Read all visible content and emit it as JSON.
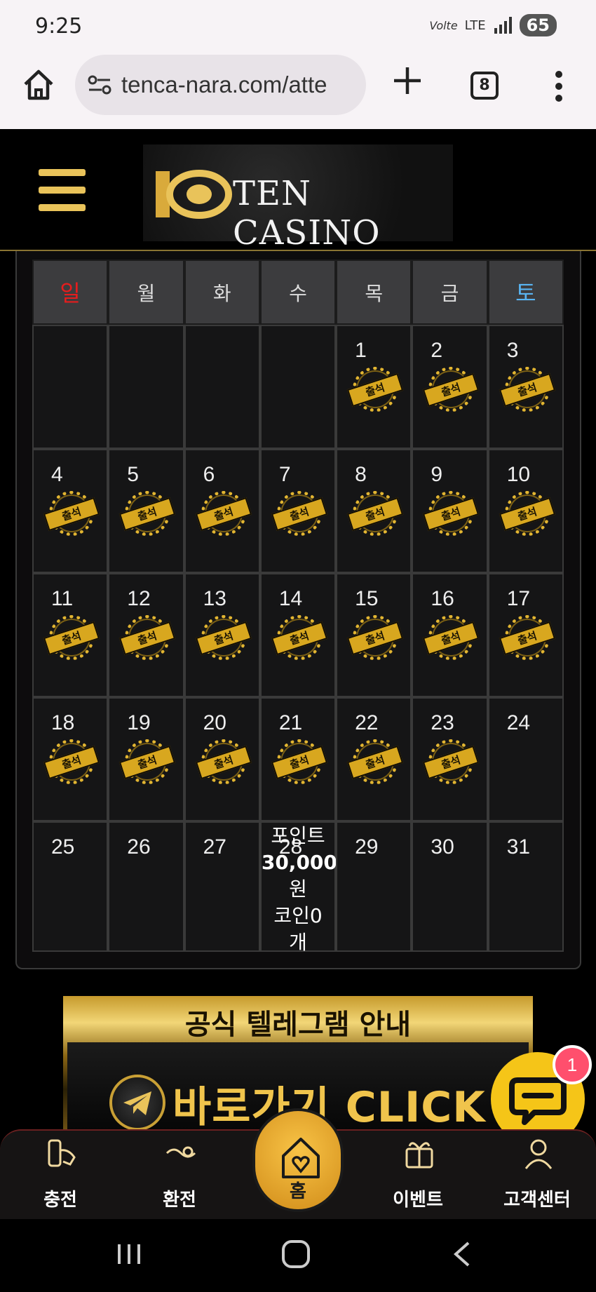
{
  "status_bar": {
    "time": "9:25",
    "volte": "Volte",
    "network": "LTE",
    "battery": "65"
  },
  "browser": {
    "url": "tenca-nara.com/atte",
    "tab_count": "8"
  },
  "site": {
    "logo_text": "TEN CASINO"
  },
  "calendar": {
    "weekdays": [
      "일",
      "월",
      "화",
      "수",
      "목",
      "금",
      "토"
    ],
    "stamp_label": "출석",
    "weeks": [
      [
        {
          "day": ""
        },
        {
          "day": ""
        },
        {
          "day": ""
        },
        {
          "day": ""
        },
        {
          "day": "1",
          "stamp": true
        },
        {
          "day": "2",
          "stamp": true
        },
        {
          "day": "3",
          "stamp": true
        }
      ],
      [
        {
          "day": "4",
          "stamp": true
        },
        {
          "day": "5",
          "stamp": true
        },
        {
          "day": "6",
          "stamp": true
        },
        {
          "day": "7",
          "stamp": true
        },
        {
          "day": "8",
          "stamp": true
        },
        {
          "day": "9",
          "stamp": true
        },
        {
          "day": "10",
          "stamp": true
        }
      ],
      [
        {
          "day": "11",
          "stamp": true
        },
        {
          "day": "12",
          "stamp": true
        },
        {
          "day": "13",
          "stamp": true
        },
        {
          "day": "14",
          "stamp": true
        },
        {
          "day": "15",
          "stamp": true
        },
        {
          "day": "16",
          "stamp": true
        },
        {
          "day": "17",
          "stamp": true
        }
      ],
      [
        {
          "day": "18",
          "stamp": true
        },
        {
          "day": "19",
          "stamp": true
        },
        {
          "day": "20",
          "stamp": true
        },
        {
          "day": "21",
          "stamp": true
        },
        {
          "day": "22",
          "stamp": true
        },
        {
          "day": "23",
          "stamp": true
        },
        {
          "day": "24"
        }
      ],
      [
        {
          "day": "25"
        },
        {
          "day": "26"
        },
        {
          "day": "27"
        },
        {
          "day": "28",
          "reward": [
            "포인트",
            "30,000",
            "원",
            "코인0",
            "개"
          ]
        },
        {
          "day": "29"
        },
        {
          "day": "30"
        },
        {
          "day": "31"
        }
      ]
    ]
  },
  "banner": {
    "title": "공식 텔레그램 안내",
    "cta": "바로가기 CLICK"
  },
  "chat": {
    "badge": "1"
  },
  "bottom_nav": {
    "items": [
      {
        "label": "충전",
        "icon": "deposit-icon"
      },
      {
        "label": "환전",
        "icon": "exchange-icon"
      },
      {
        "label": "홈",
        "icon": "home-heart-icon"
      },
      {
        "label": "이벤트",
        "icon": "gift-icon"
      },
      {
        "label": "고객센터",
        "icon": "support-icon"
      }
    ]
  },
  "colors": {
    "gold": "#e9c35a",
    "sunday": "#e61d1d",
    "saturday": "#59b4f2",
    "chat": "#f5c518",
    "badge": "#ff4f6d"
  }
}
